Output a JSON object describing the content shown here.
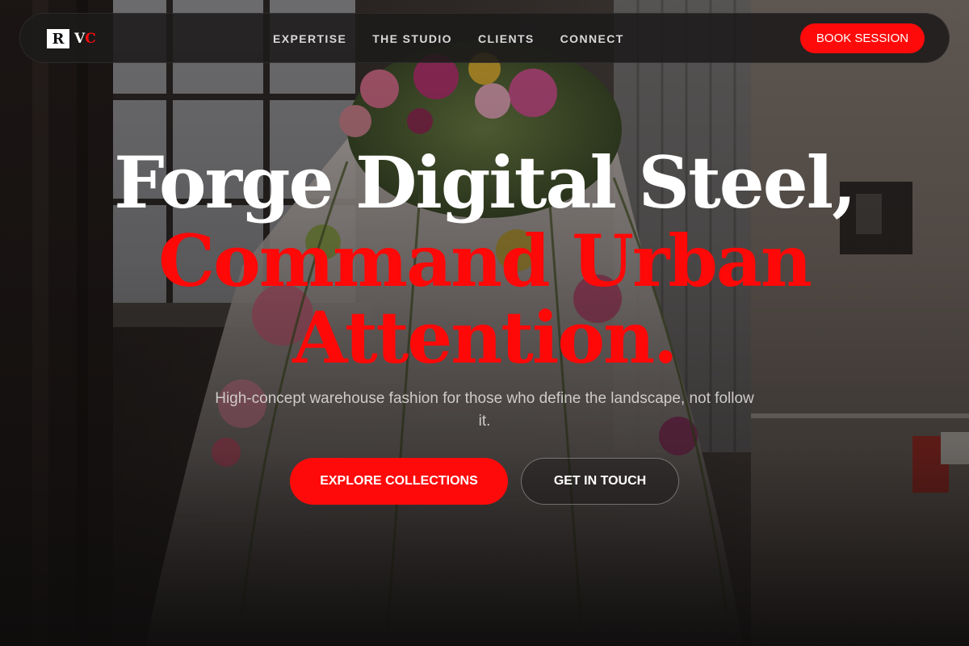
{
  "brand": {
    "logo_letter": "R",
    "logo_rest_1": "V",
    "logo_rest_2": "C",
    "accent": "#ff0a0a"
  },
  "nav": {
    "links": [
      "EXPERTISE",
      "THE STUDIO",
      "CLIENTS",
      "CONNECT"
    ],
    "cta_label": "BOOK SESSION"
  },
  "hero": {
    "title_line1": "Forge Digital Steel,",
    "title_line2": "Command Urban",
    "title_line3": "Attention.",
    "subtitle": "High-concept warehouse fashion for those who define the landscape, not follow it.",
    "primary_cta": "EXPLORE COLLECTIONS",
    "secondary_cta": "GET IN TOUCH"
  },
  "background": {
    "icon": "floral-dress-warehouse-photo"
  }
}
